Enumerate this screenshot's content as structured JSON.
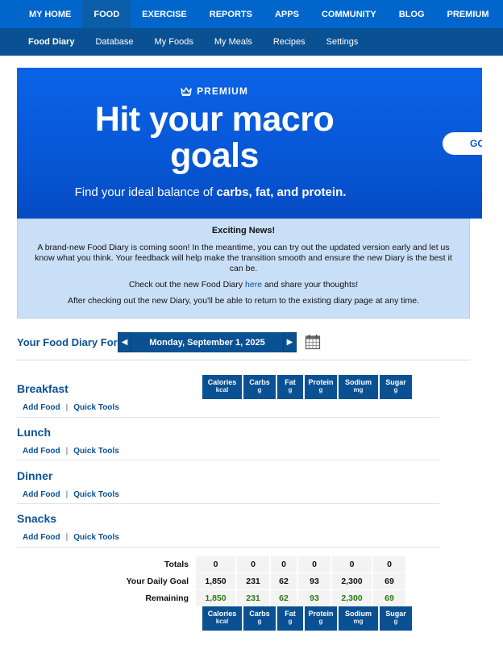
{
  "topnav": {
    "items": [
      "MY HOME",
      "FOOD",
      "EXERCISE",
      "REPORTS",
      "APPS",
      "COMMUNITY",
      "BLOG",
      "PREMIUM"
    ],
    "active": "FOOD"
  },
  "subnav": {
    "items": [
      "Food Diary",
      "Database",
      "My Foods",
      "My Meals",
      "Recipes",
      "Settings"
    ],
    "active": "Food Diary"
  },
  "banner": {
    "premium_label": "PREMIUM",
    "headline_line1": "Hit your macro",
    "headline_line2": "goals",
    "tagline_prefix": "Find your ideal balance of ",
    "tagline_bold": "carbs, fat, and protein.",
    "go_button": "GO"
  },
  "news": {
    "title": "Exciting News!",
    "para1": "A brand-new Food Diary is coming soon! In the meantime, you can try out the updated version early and let us know what you think. Your feedback will help make the transition smooth and ensure the new Diary is the best it can be.",
    "para2_prefix": "Check out the new Food Diary ",
    "para2_link": "here",
    "para2_suffix": " and share your thoughts!",
    "para3": "After checking out the new Diary, you'll be able to return to the existing diary page at any time."
  },
  "diary": {
    "label": "Your Food Diary For:",
    "date": "Monday, September 1, 2025",
    "prev_icon": "caret-left-icon",
    "next_icon": "caret-right-icon",
    "calendar_icon": "calendar-icon"
  },
  "meals": [
    {
      "name": "Breakfast",
      "add_food": "Add Food",
      "quick_tools": "Quick Tools"
    },
    {
      "name": "Lunch",
      "add_food": "Add Food",
      "quick_tools": "Quick Tools"
    },
    {
      "name": "Dinner",
      "add_food": "Add Food",
      "quick_tools": "Quick Tools"
    },
    {
      "name": "Snacks",
      "add_food": "Add Food",
      "quick_tools": "Quick Tools"
    }
  ],
  "nutrients": [
    {
      "name": "Calories",
      "unit": "kcal"
    },
    {
      "name": "Carbs",
      "unit": "g"
    },
    {
      "name": "Fat",
      "unit": "g"
    },
    {
      "name": "Protein",
      "unit": "g"
    },
    {
      "name": "Sodium",
      "unit": "mg"
    },
    {
      "name": "Sugar",
      "unit": "g"
    }
  ],
  "totals": {
    "rows": [
      {
        "label": "Totals",
        "values": [
          "0",
          "0",
          "0",
          "0",
          "0",
          "0"
        ]
      },
      {
        "label": "Your Daily Goal",
        "values": [
          "1,850",
          "231",
          "62",
          "93",
          "2,300",
          "69"
        ]
      },
      {
        "label": "Remaining",
        "values": [
          "1,850",
          "231",
          "62",
          "93",
          "2,300",
          "69"
        ]
      }
    ]
  },
  "colors": {
    "nav_blue": "#0066cc",
    "subnav_blue": "#0a5194",
    "banner_blue": "#0757d6",
    "news_bg": "#c9dff7",
    "remaining_green": "#2a7a12"
  }
}
